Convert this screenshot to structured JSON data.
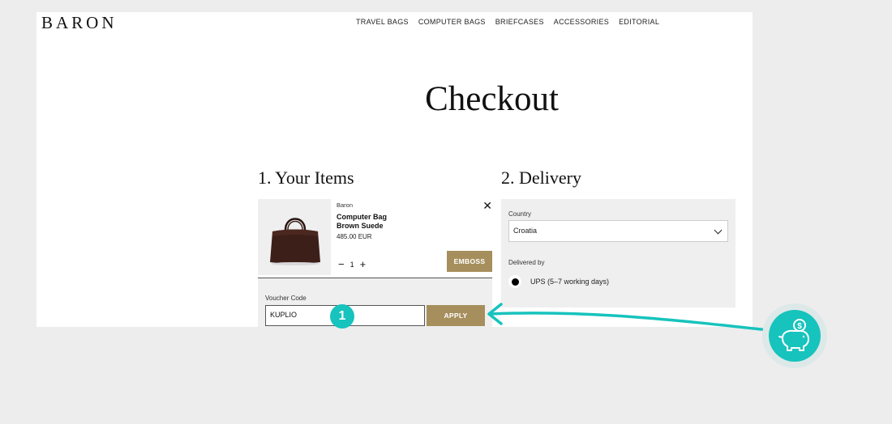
{
  "header": {
    "logo": "BARON",
    "nav": [
      "TRAVEL BAGS",
      "COMPUTER BAGS",
      "BRIEFCASES",
      "ACCESSORIES",
      "EDITORIAL"
    ]
  },
  "page_title": "Checkout",
  "items_section": {
    "heading": "1. Your Items",
    "item": {
      "brand": "Baron",
      "name_line1": "Computer Bag",
      "name_line2": "Brown Suede",
      "price": "485.00 EUR",
      "quantity": "1",
      "remove_icon": "close-icon",
      "emboss_label": "EMBOSS"
    },
    "voucher": {
      "label": "Voucher Code",
      "value": "KUPLIO",
      "apply_label": "APPLY"
    }
  },
  "delivery_section": {
    "heading": "2. Delivery",
    "country_label": "Country",
    "country_value": "Croatia",
    "delivered_by_label": "Delivered by",
    "shipping_option": "UPS (5–7 working days)"
  },
  "annotation": {
    "step_number": "1",
    "accent_color": "#17c3bd",
    "icon": "piggy-bank-dollar-icon"
  },
  "colors": {
    "button_gold": "#a68f5d",
    "background": "#ededed"
  }
}
